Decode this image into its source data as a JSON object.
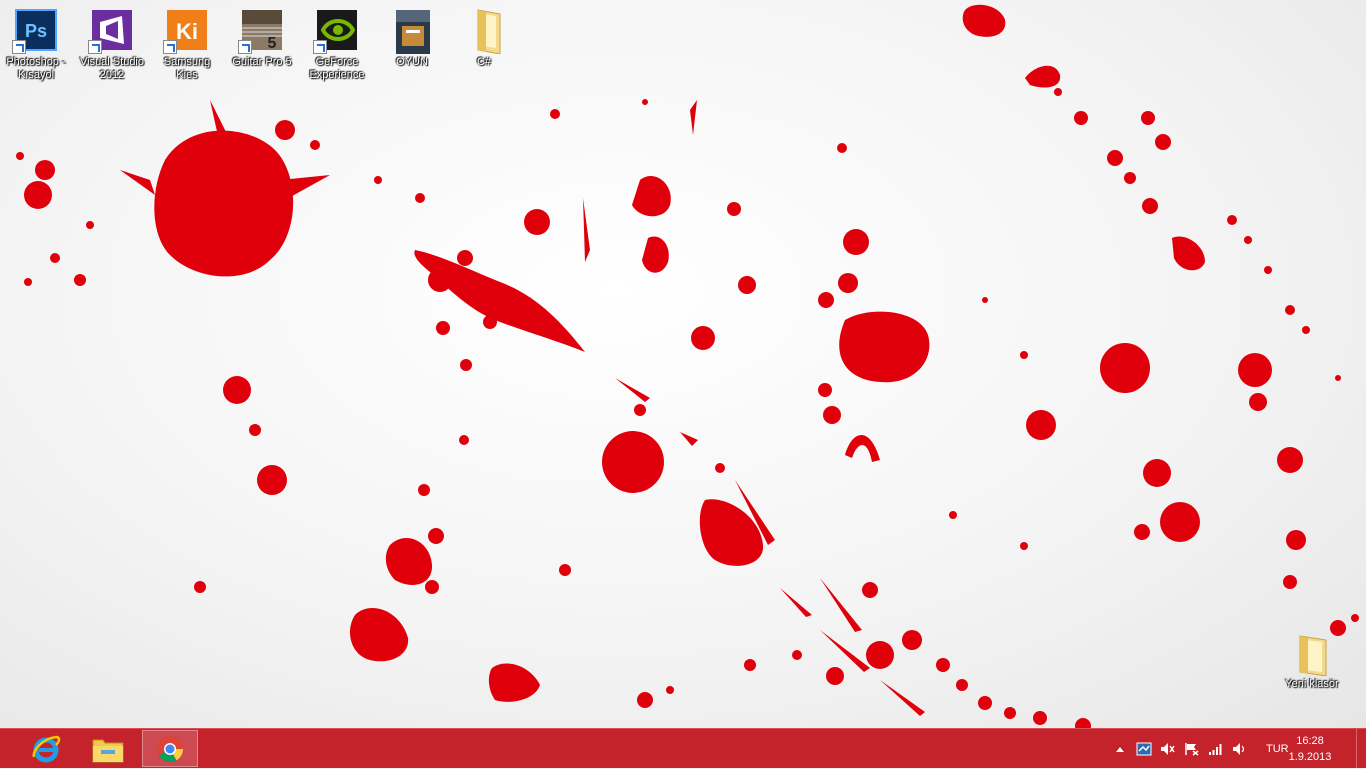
{
  "desktop": {
    "icons": [
      {
        "label": "Photoshop -\nKısayol",
        "icon": "photoshop-icon"
      },
      {
        "label": "Visual Studio\n2012",
        "icon": "visual-studio-icon"
      },
      {
        "label": "Samsung\nKies",
        "icon": "samsung-kies-icon"
      },
      {
        "label": "Guitar Pro 5",
        "icon": "guitar-pro-icon"
      },
      {
        "label": "GeForce\nExperience",
        "icon": "geforce-icon"
      },
      {
        "label": "OYUN",
        "icon": "game-icon"
      },
      {
        "label": "C#",
        "icon": "folder-icon"
      }
    ],
    "folder_new": {
      "label": "Yeni klasör",
      "icon": "folder-icon"
    }
  },
  "taskbar": {
    "pinned": [
      {
        "name": "internet-explorer",
        "icon": "ie-icon"
      },
      {
        "name": "file-explorer",
        "icon": "file-explorer-icon"
      },
      {
        "name": "chrome",
        "icon": "chrome-icon",
        "active": true
      }
    ],
    "tray": {
      "language": "TUR",
      "time": "16:28",
      "date": "1.9.2013"
    }
  },
  "colors": {
    "taskbar": "#c4232c",
    "blood": "#e0000b"
  }
}
